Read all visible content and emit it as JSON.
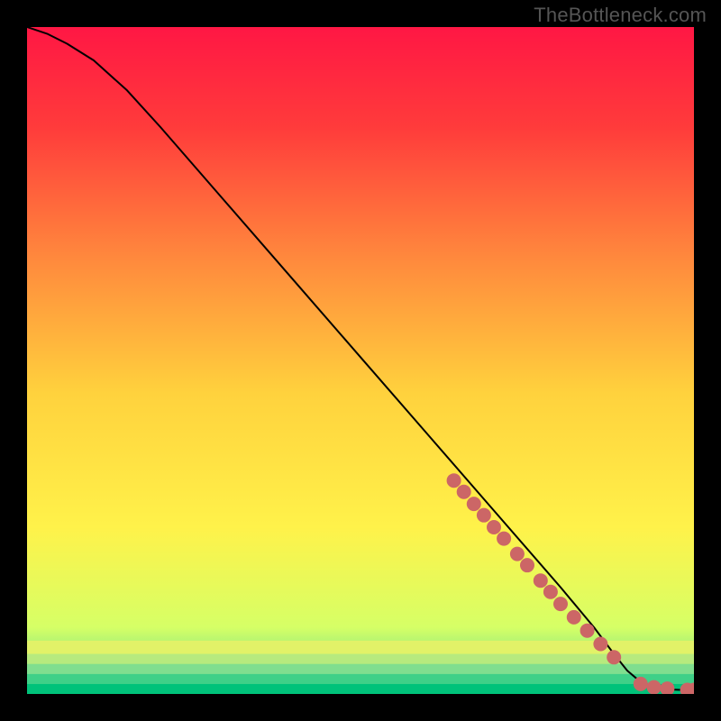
{
  "watermark": "TheBottleneck.com",
  "chart_data": {
    "type": "line",
    "title": "",
    "xlabel": "",
    "ylabel": "",
    "xlim": [
      0,
      100
    ],
    "ylim": [
      0,
      100
    ],
    "curve": {
      "name": "bottleneck-curve",
      "x": [
        0,
        3,
        6,
        10,
        15,
        20,
        30,
        40,
        50,
        60,
        70,
        80,
        85,
        88,
        90,
        92,
        94,
        96,
        98,
        100
      ],
      "y": [
        100,
        99,
        97.5,
        95,
        90.5,
        85,
        73.5,
        62,
        50.5,
        39,
        27.5,
        16,
        10,
        6,
        3.5,
        1.8,
        1,
        0.7,
        0.6,
        0.5
      ]
    },
    "points": {
      "name": "data-points",
      "color": "#cc6666",
      "x": [
        64,
        65.5,
        67,
        68.5,
        70,
        71.5,
        73.5,
        75,
        77,
        78.5,
        80,
        82,
        84,
        86,
        88,
        92,
        94,
        96,
        99,
        100
      ],
      "y": [
        32,
        30.3,
        28.5,
        26.8,
        25,
        23.3,
        21,
        19.3,
        17,
        15.3,
        13.5,
        11.5,
        9.5,
        7.5,
        5.5,
        1.5,
        1,
        0.8,
        0.6,
        0.6
      ]
    },
    "background": {
      "type": "vertical-gradient",
      "stops": [
        {
          "offset": 0.0,
          "color": "#ff1744"
        },
        {
          "offset": 0.15,
          "color": "#ff3b3b"
        },
        {
          "offset": 0.35,
          "color": "#ff8a3d"
        },
        {
          "offset": 0.55,
          "color": "#ffd23d"
        },
        {
          "offset": 0.75,
          "color": "#fff24a"
        },
        {
          "offset": 0.9,
          "color": "#d6ff66"
        },
        {
          "offset": 0.97,
          "color": "#6fe089"
        },
        {
          "offset": 1.0,
          "color": "#00c27a"
        }
      ],
      "bottom_bands": [
        {
          "y_from": 0.0,
          "y_to": 1.5,
          "color": "#00c27a"
        },
        {
          "y_from": 1.5,
          "y_to": 3.0,
          "color": "#3fd088"
        },
        {
          "y_from": 3.0,
          "y_to": 4.5,
          "color": "#80de8f"
        },
        {
          "y_from": 4.5,
          "y_to": 6.0,
          "color": "#b7ea7e"
        },
        {
          "y_from": 6.0,
          "y_to": 8.0,
          "color": "#e2f268"
        }
      ]
    }
  }
}
